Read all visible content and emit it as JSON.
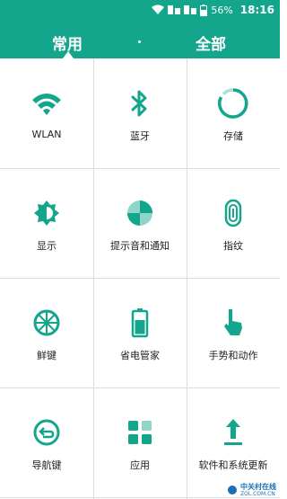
{
  "status_bar": {
    "battery_text": "56%",
    "time": "18:16"
  },
  "tabs": [
    {
      "label": "常用"
    },
    {
      "label": "全部"
    }
  ],
  "grid": [
    {
      "label": "WLAN",
      "icon": "wifi-icon"
    },
    {
      "label": "蓝牙",
      "icon": "bluetooth-icon"
    },
    {
      "label": "存储",
      "icon": "storage-icon"
    },
    {
      "label": "显示",
      "icon": "display-icon"
    },
    {
      "label": "提示音和通知",
      "icon": "sound-notification-icon"
    },
    {
      "label": "指纹",
      "icon": "fingerprint-icon"
    },
    {
      "label": "鲜键",
      "icon": "fresh-key-icon"
    },
    {
      "label": "省电管家",
      "icon": "battery-icon"
    },
    {
      "label": "手势和动作",
      "icon": "gesture-icon"
    },
    {
      "label": "导航键",
      "icon": "navigation-key-icon"
    },
    {
      "label": "应用",
      "icon": "apps-icon"
    },
    {
      "label": "软件和系统更新",
      "icon": "update-icon"
    }
  ],
  "watermark": {
    "text": "中关村在线",
    "sub": "ZOL.COM.CN"
  },
  "colors": {
    "accent": "#14a68c",
    "divider": "#dcdcdc"
  }
}
